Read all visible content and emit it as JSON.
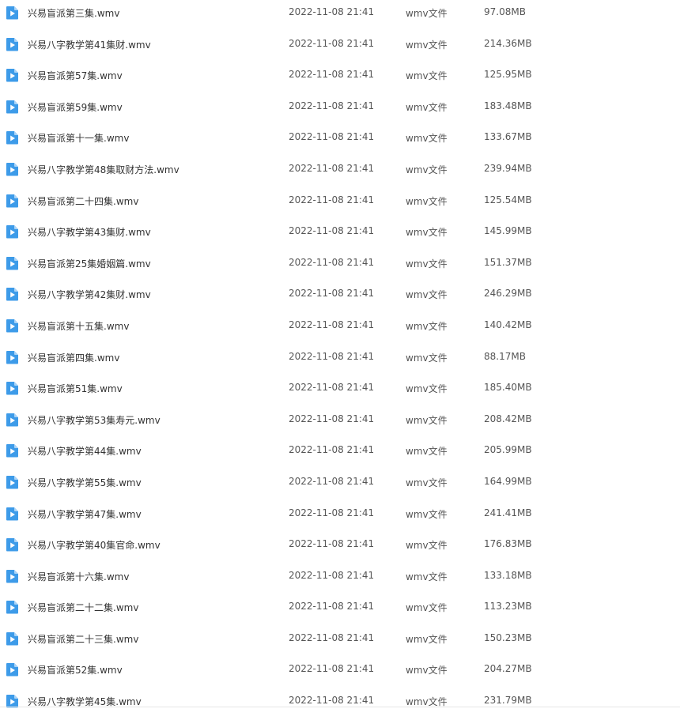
{
  "colors": {
    "icon_blue": "#3d9be9",
    "icon_fold": "#a9d3f7",
    "text": "#333333"
  },
  "file_icon": "video-file-icon",
  "files": [
    {
      "name": "兴易盲派第三集.wmv",
      "date": "2022-11-08 21:41",
      "type": "wmv文件",
      "size": "97.08MB"
    },
    {
      "name": "兴易八字教学第41集财.wmv",
      "date": "2022-11-08 21:41",
      "type": "wmv文件",
      "size": "214.36MB"
    },
    {
      "name": "兴易盲派第57集.wmv",
      "date": "2022-11-08 21:41",
      "type": "wmv文件",
      "size": "125.95MB"
    },
    {
      "name": "兴易盲派第59集.wmv",
      "date": "2022-11-08 21:41",
      "type": "wmv文件",
      "size": "183.48MB"
    },
    {
      "name": "兴易盲派第十一集.wmv",
      "date": "2022-11-08 21:41",
      "type": "wmv文件",
      "size": "133.67MB"
    },
    {
      "name": "兴易八字教学第48集取财方法.wmv",
      "date": "2022-11-08 21:41",
      "type": "wmv文件",
      "size": "239.94MB"
    },
    {
      "name": "兴易盲派第二十四集.wmv",
      "date": "2022-11-08 21:41",
      "type": "wmv文件",
      "size": "125.54MB"
    },
    {
      "name": "兴易八字教学第43集财.wmv",
      "date": "2022-11-08 21:41",
      "type": "wmv文件",
      "size": "145.99MB"
    },
    {
      "name": "兴易盲派第25集婚姻篇.wmv",
      "date": "2022-11-08 21:41",
      "type": "wmv文件",
      "size": "151.37MB"
    },
    {
      "name": "兴易八字教学第42集财.wmv",
      "date": "2022-11-08 21:41",
      "type": "wmv文件",
      "size": "246.29MB"
    },
    {
      "name": "兴易盲派第十五集.wmv",
      "date": "2022-11-08 21:41",
      "type": "wmv文件",
      "size": "140.42MB"
    },
    {
      "name": "兴易盲派第四集.wmv",
      "date": "2022-11-08 21:41",
      "type": "wmv文件",
      "size": "88.17MB"
    },
    {
      "name": "兴易盲派第51集.wmv",
      "date": "2022-11-08 21:41",
      "type": "wmv文件",
      "size": "185.40MB"
    },
    {
      "name": "兴易八字教学第53集寿元.wmv",
      "date": "2022-11-08 21:41",
      "type": "wmv文件",
      "size": "208.42MB"
    },
    {
      "name": "兴易八字教学第44集.wmv",
      "date": "2022-11-08 21:41",
      "type": "wmv文件",
      "size": "205.99MB"
    },
    {
      "name": "兴易八字教学第55集.wmv",
      "date": "2022-11-08 21:41",
      "type": "wmv文件",
      "size": "164.99MB"
    },
    {
      "name": "兴易八字教学第47集.wmv",
      "date": "2022-11-08 21:41",
      "type": "wmv文件",
      "size": "241.41MB"
    },
    {
      "name": "兴易八字教学第40集官命.wmv",
      "date": "2022-11-08 21:41",
      "type": "wmv文件",
      "size": "176.83MB"
    },
    {
      "name": "兴易盲派第十六集.wmv",
      "date": "2022-11-08 21:41",
      "type": "wmv文件",
      "size": "133.18MB"
    },
    {
      "name": "兴易盲派第二十二集.wmv",
      "date": "2022-11-08 21:41",
      "type": "wmv文件",
      "size": "113.23MB"
    },
    {
      "name": "兴易盲派第二十三集.wmv",
      "date": "2022-11-08 21:41",
      "type": "wmv文件",
      "size": "150.23MB"
    },
    {
      "name": "兴易盲派第52集.wmv",
      "date": "2022-11-08 21:41",
      "type": "wmv文件",
      "size": "204.27MB"
    },
    {
      "name": "兴易八字教学第45集.wmv",
      "date": "2022-11-08 21:41",
      "type": "wmv文件",
      "size": "231.79MB"
    }
  ]
}
